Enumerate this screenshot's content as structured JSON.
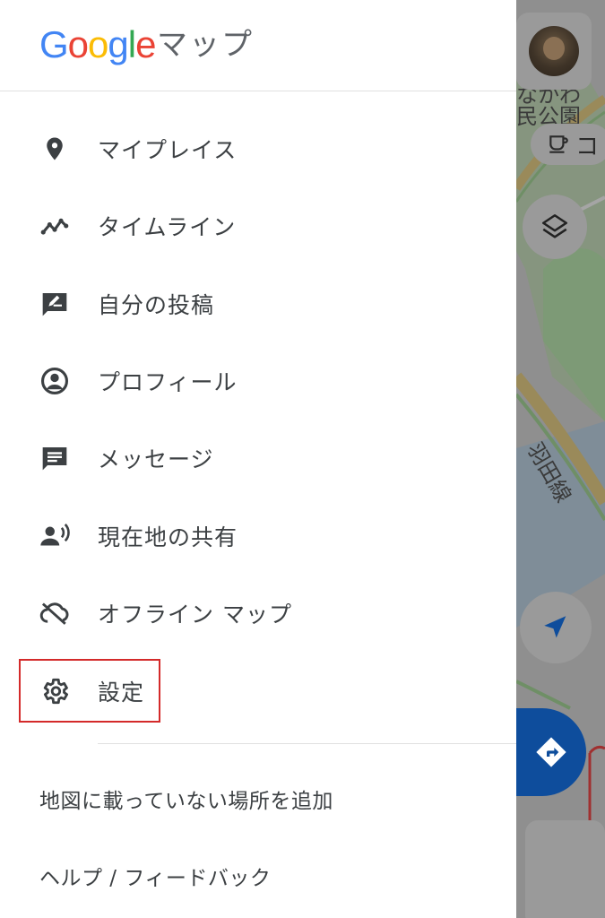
{
  "header": {
    "logo_text": "Google",
    "app_name": "マップ"
  },
  "menu": {
    "items": [
      {
        "label": "マイプレイス",
        "icon": "place-pin-icon"
      },
      {
        "label": "タイムライン",
        "icon": "timeline-icon"
      },
      {
        "label": "自分の投稿",
        "icon": "rate-review-icon"
      },
      {
        "label": "プロフィール",
        "icon": "account-circle-icon"
      },
      {
        "label": "メッセージ",
        "icon": "message-icon"
      },
      {
        "label": "現在地の共有",
        "icon": "location-sharing-icon"
      },
      {
        "label": "オフライン マップ",
        "icon": "offline-cloud-icon"
      },
      {
        "label": "設定",
        "icon": "gear-icon"
      }
    ],
    "secondary": [
      {
        "label": "地図に載っていない場所を追加"
      },
      {
        "label": "ヘルプ / フィードバック"
      }
    ]
  },
  "map": {
    "park_label_line1": "なかわ",
    "park_label_line2": "民公園",
    "cafe_chip_label": "コ",
    "road_label": "羽田線"
  },
  "colors": {
    "highlight_border": "#d42a2a",
    "google_blue": "#4285f4",
    "google_red": "#ea4335",
    "google_yellow": "#fbbc05",
    "google_green": "#34a853",
    "directions_blue": "#0e4d9c",
    "icon_gray": "#3c4043"
  }
}
